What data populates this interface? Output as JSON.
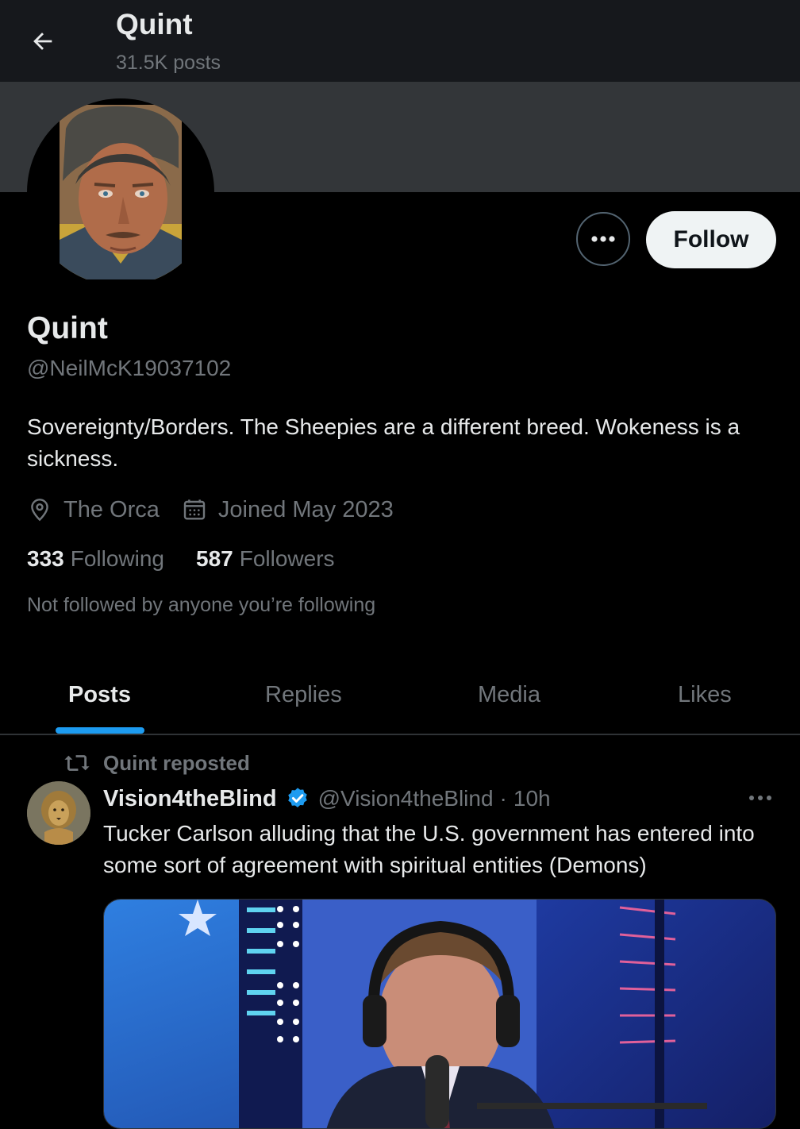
{
  "header": {
    "title": "Quint",
    "post_count": "31.5K posts"
  },
  "profile": {
    "display_name": "Quint",
    "handle": "@NeilMcK19037102",
    "bio": "Sovereignty/Borders. The Sheepies are a different breed. Wokeness is a sickness.",
    "location": "The Orca",
    "joined": "Joined May 2023",
    "following_count": "333",
    "following_label": "Following",
    "followers_count": "587",
    "followers_label": "Followers",
    "not_followed_note": "Not followed by anyone you’re following",
    "follow_label": "Follow"
  },
  "tabs": [
    {
      "label": "Posts",
      "active": true
    },
    {
      "label": "Replies",
      "active": false
    },
    {
      "label": "Media",
      "active": false
    },
    {
      "label": "Likes",
      "active": false
    }
  ],
  "post": {
    "repost_label": "Quint reposted",
    "author": "Vision4theBlind",
    "handle": "@Vision4theBlind",
    "separator": "·",
    "time": "10h",
    "text": "Tucker Carlson alluding that the U.S. government has entered into some sort of agreement with spiritual entities (Demons)"
  },
  "colors": {
    "accent": "#1d9bf0",
    "background": "#000000",
    "text_primary": "#e7e9ea",
    "text_secondary": "#71767b"
  }
}
